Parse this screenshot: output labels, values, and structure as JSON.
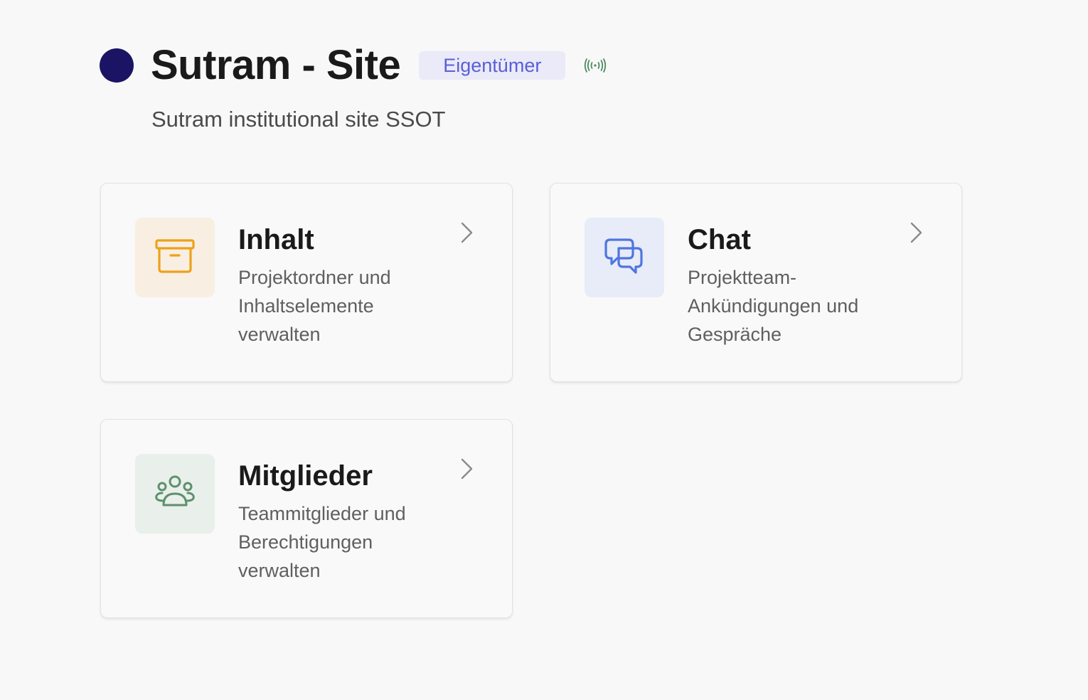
{
  "header": {
    "title": "Sutram - Site",
    "role_badge": "Eigentümer",
    "subtitle": "Sutram institutional site SSOT"
  },
  "colors": {
    "site_dot": "#1b1464",
    "badge_bg": "#eaeaf8",
    "badge_text": "#5a5fd6",
    "live_icon": "#4c8a5e"
  },
  "cards": [
    {
      "title": "Inhalt",
      "description": "Projektordner und Inhaltselemente verwalten",
      "icon": "archive-box-icon",
      "icon_bg": "#f8efe2",
      "icon_color": "#eea01b"
    },
    {
      "title": "Chat",
      "description": "Projektteam-Ankündigungen und Gespräche",
      "icon": "chat-bubbles-icon",
      "icon_bg": "#e8ecf8",
      "icon_color": "#4f76e0"
    },
    {
      "title": "Mitglieder",
      "description": "Teammitglieder und Berechtigungen verwalten",
      "icon": "users-group-icon",
      "icon_bg": "#e9efea",
      "icon_color": "#5f8f6f"
    }
  ]
}
